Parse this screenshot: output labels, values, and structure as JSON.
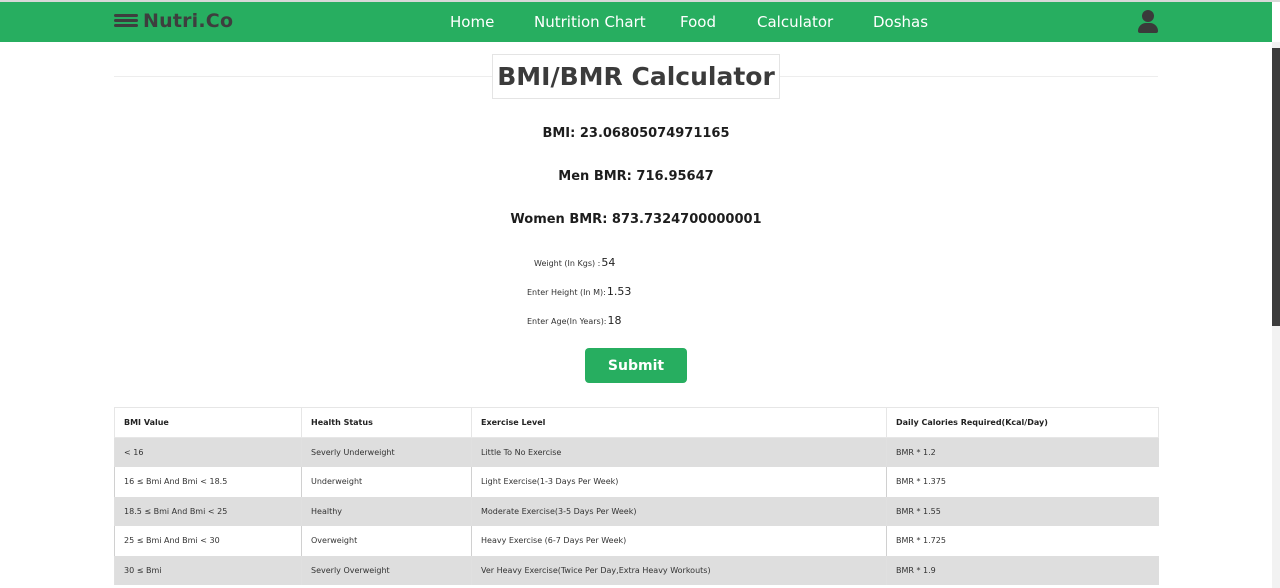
{
  "brand": {
    "name": "Nutri.Co",
    "icon": "waves-icon"
  },
  "nav": {
    "links": [
      "Home",
      "Nutrition Chart",
      "Food",
      "Calculator",
      "Doshas"
    ],
    "user_icon": "user-icon",
    "color": "#27ae60"
  },
  "page": {
    "title": "BMI/BMR Calculator"
  },
  "results": {
    "bmi": "BMI: 23.06805074971165",
    "men_bmr": "Men BMR: 716.95647",
    "women_bmr": "Women BMR: 873.7324700000001"
  },
  "form": {
    "weight": {
      "label": "Weight (In Kgs) :",
      "value": "54"
    },
    "height": {
      "label": "Enter Height (In M):",
      "value": "1.53"
    },
    "age": {
      "label": "Enter Age(In Years):",
      "value": "18"
    },
    "submit_label": "Submit"
  },
  "table": {
    "headers": [
      "BMI Value",
      "Health Status",
      "Exercise Level",
      "Daily Calories Required(Kcal/Day)"
    ],
    "rows": [
      [
        "< 16",
        "Severly Underweight",
        "Little To No Exercise",
        "BMR * 1.2"
      ],
      [
        "16 ≤ Bmi And Bmi < 18.5",
        "Underweight",
        "Light Exercise(1-3 Days Per Week)",
        "BMR * 1.375"
      ],
      [
        "18.5 ≤ Bmi And Bmi < 25",
        "Healthy",
        "Moderate Exercise(3-5 Days Per Week)",
        "BMR * 1.55"
      ],
      [
        "25 ≤ Bmi And Bmi < 30",
        "Overweight",
        "Heavy Exercise (6-7 Days Per Week)",
        "BMR * 1.725"
      ],
      [
        "30 ≤ Bmi",
        "Severly Overweight",
        "Ver Heavy Exercise(Twice Per Day,Extra Heavy Workouts)",
        "BMR * 1.9"
      ]
    ]
  }
}
